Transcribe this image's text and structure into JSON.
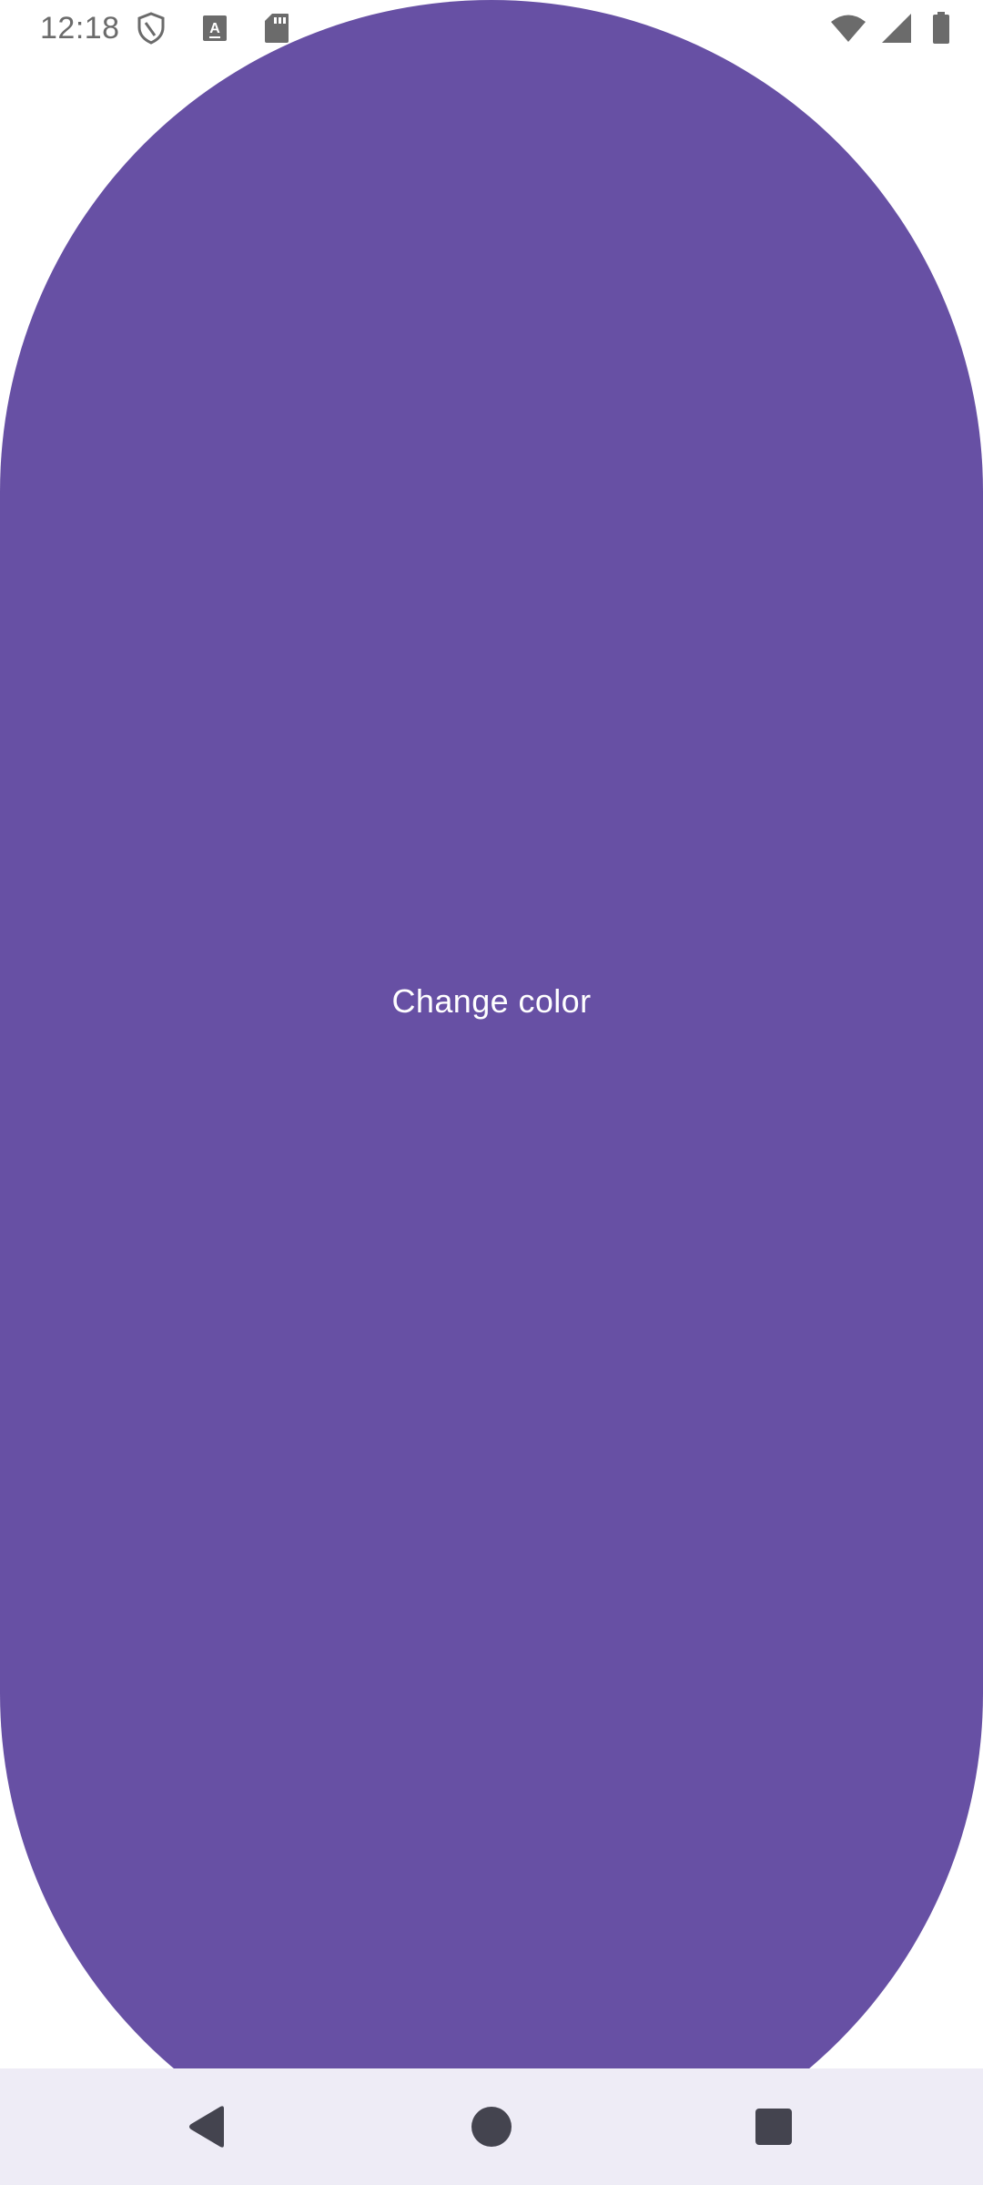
{
  "status_bar": {
    "time": "12:18",
    "left_icons": [
      "shield-icon",
      "text-recognition-icon",
      "sd-card-icon"
    ],
    "right_icons": [
      "wifi-icon",
      "cellular-signal-icon",
      "battery-icon"
    ],
    "icon_color": "#6b6b6b"
  },
  "main": {
    "button_label": "Change color",
    "button_color": "#6750A4",
    "label_color": "#FFFFFF"
  },
  "nav_bar": {
    "background": "#EEECF6",
    "buttons": [
      "back-icon",
      "home-icon",
      "recents-icon"
    ],
    "icon_color": "#44444F"
  }
}
